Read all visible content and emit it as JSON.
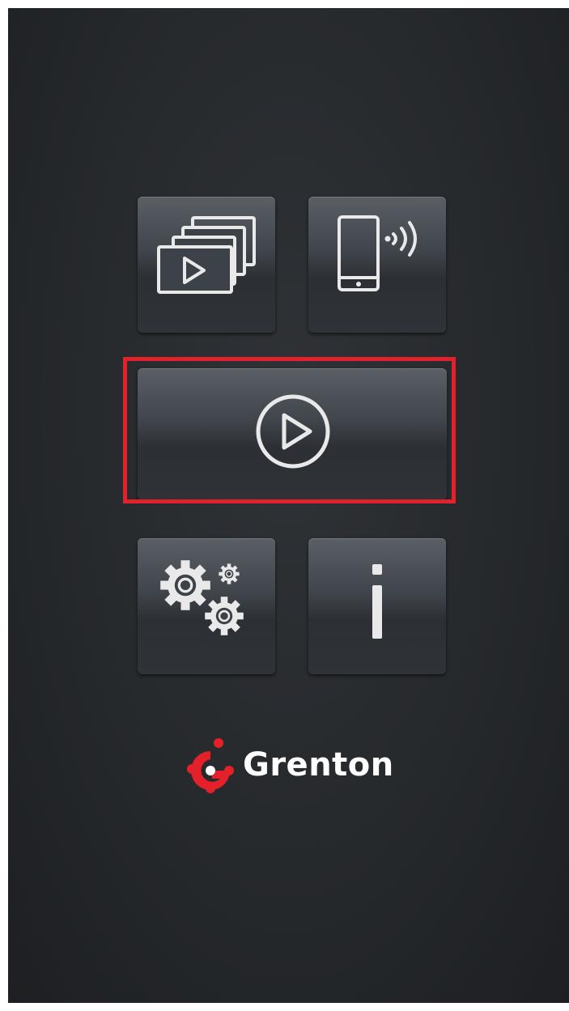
{
  "menu": {
    "tiles": [
      {
        "icon": "scenes-slideshow-icon"
      },
      {
        "icon": "phone-wireless-icon"
      },
      {
        "icon": "play-circle-icon"
      },
      {
        "icon": "gears-icon"
      },
      {
        "icon": "info-icon"
      }
    ],
    "info_glyph": "i"
  },
  "brand": {
    "name": "Grenton",
    "logo_color": "#e4202a"
  },
  "highlight": {
    "color": "#e4202a"
  }
}
